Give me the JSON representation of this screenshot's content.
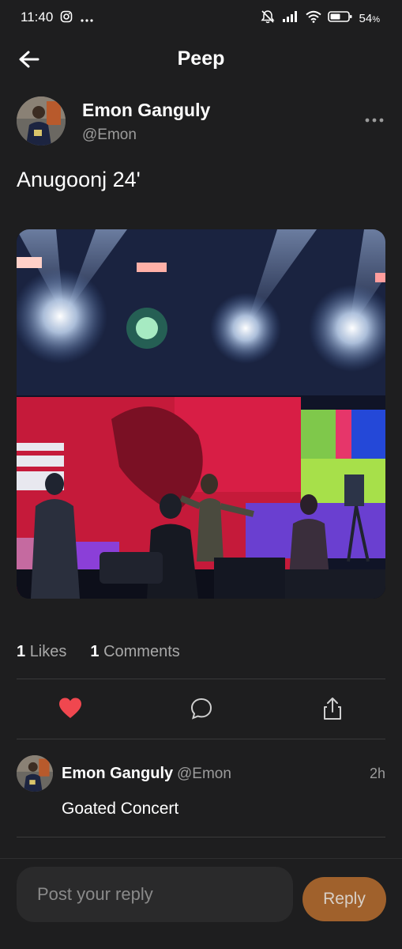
{
  "status_bar": {
    "time": "11:40",
    "battery": "54",
    "battery_unit": "%",
    "icons": [
      "instagram-icon",
      "more-dots-icon",
      "mute-icon",
      "signal-icon",
      "wifi-icon",
      "battery-icon"
    ]
  },
  "header": {
    "title": "Peep"
  },
  "post": {
    "author_name": "Emon Ganguly",
    "author_handle": "@Emon",
    "text": "Anugoonj 24'",
    "likes_count": "1",
    "likes_label": "Likes",
    "comments_count": "1",
    "comments_label": "Comments",
    "liked": true
  },
  "comments": [
    {
      "author_name": "Emon Ganguly",
      "author_handle": "@Emon",
      "time": "2h",
      "text": "Goated Concert"
    }
  ],
  "reply": {
    "placeholder": "Post your reply",
    "button_label": "Reply"
  },
  "colors": {
    "background": "#1e1e1f",
    "accent": "#a0612c",
    "like": "#f0474f",
    "muted_text": "#9b9b9b"
  }
}
